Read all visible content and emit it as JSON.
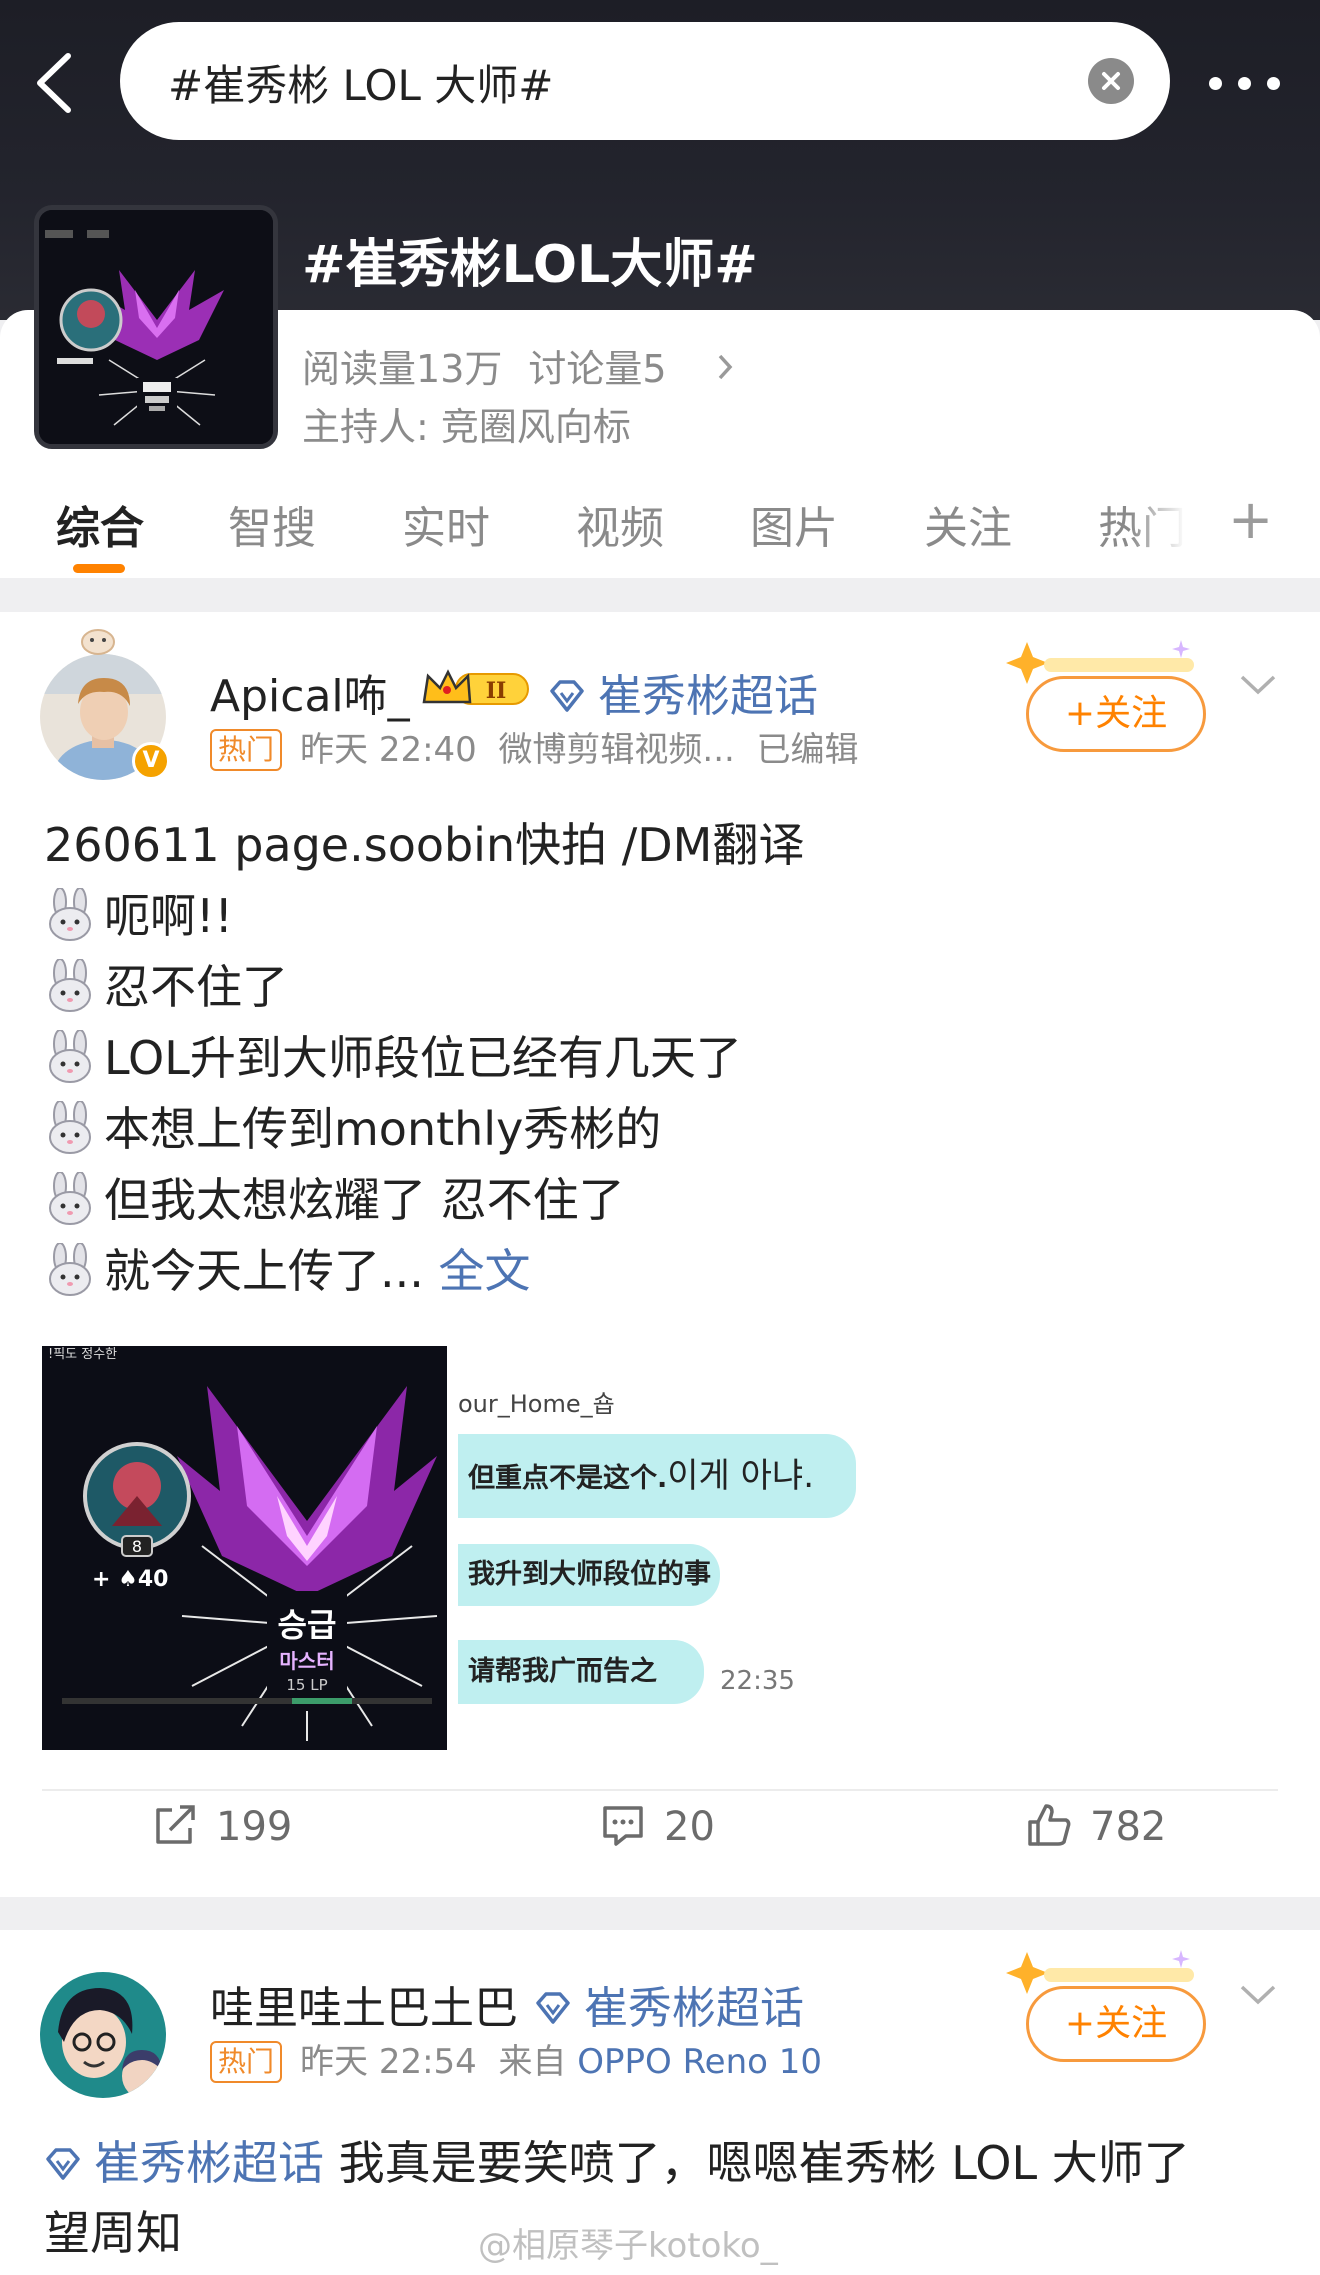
{
  "header": {
    "search_text": "#崔秀彬 LOL 大师#",
    "topic_title": "#崔秀彬LOL大师#",
    "stats": {
      "reads_label": "阅读量",
      "reads": "13万",
      "discussions_label": "讨论量",
      "discussions": "5"
    },
    "host_label": "主持人:",
    "host": "竞圈风向标"
  },
  "tabs": [
    {
      "label": "综合",
      "active": true
    },
    {
      "label": "智搜"
    },
    {
      "label": "实时"
    },
    {
      "label": "视频"
    },
    {
      "label": "图片"
    },
    {
      "label": "关注"
    },
    {
      "label": "热门"
    }
  ],
  "tab_add_label": "+",
  "colors": {
    "accent": "#ff8200",
    "link": "#4d74b3",
    "hot": "#f08a2a",
    "header_bg": "#1d1e26",
    "chat_bubble": "#bfeff0"
  },
  "posts": [
    {
      "username": "Apical咘_",
      "level_badge": "II",
      "supertopic": "崔秀彬超话",
      "hot_label": "热门",
      "time": "昨天 22:40",
      "source": "微博剪辑视频...",
      "edited": "已编辑",
      "follow_label": "+关注",
      "body_lines": [
        "260611 page.soobin快拍 /DM翻译",
        "呃啊!!",
        "忍不住了",
        "LOL升到大师段位已经有几天了",
        "本想上传到monthly秀彬的",
        "但我太想炫耀了 忍不住了",
        "就今天上传了..."
      ],
      "more_label": "全文",
      "images": {
        "game": {
          "top_left_text": "!픽도   정수한",
          "level": "8",
          "lp_gain": "+ ♠40",
          "promo": "승급",
          "rank": "마스터",
          "lp": "15 LP"
        },
        "chat": {
          "name": "our_Home_숍",
          "messages": [
            {
              "zh": "但重点不是这个.",
              "ko": "이게 아냐."
            },
            {
              "zh": "我升到大师段位的事",
              "ko": ""
            },
            {
              "zh": "请帮我广而告之",
              "ko": ""
            }
          ],
          "time": "22:35"
        }
      },
      "actions": {
        "reposts": "199",
        "comments": "20",
        "likes": "782"
      }
    },
    {
      "username": "哇里哇土巴土巴",
      "supertopic": "崔秀彬超话",
      "hot_label": "热门",
      "time": "昨天 22:54",
      "source_prefix": "来自",
      "source": "OPPO Reno 10",
      "follow_label": "+关注",
      "body_tag": "崔秀彬超话",
      "body_line1": "我真是要笑喷了，嗯嗯崔秀彬 LOL 大师了",
      "body_line2": "望周知"
    }
  ],
  "watermark": "@相原琴子kotoko_"
}
